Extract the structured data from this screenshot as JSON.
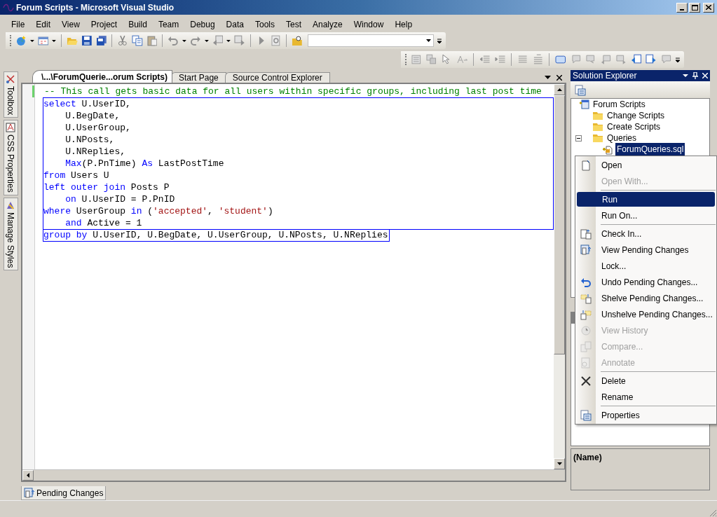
{
  "window": {
    "title": "Forum Scripts - Microsoft Visual Studio"
  },
  "menu_bar": [
    "File",
    "Edit",
    "View",
    "Project",
    "Build",
    "Team",
    "Debug",
    "Data",
    "Tools",
    "Test",
    "Analyze",
    "Window",
    "Help"
  ],
  "side_tabs": [
    "Toolbox",
    "CSS Properties",
    "Manage Styles"
  ],
  "editor_tabs": [
    {
      "label": "\\...\\ForumQuerie...orum Scripts)",
      "selected": true
    },
    {
      "label": "Start Page",
      "selected": false
    },
    {
      "label": "Source Control Explorer",
      "selected": false
    }
  ],
  "code_lines": [
    {
      "modified": true,
      "selected": false,
      "segments": [
        {
          "kind": "comment",
          "text": "-- This call gets basic data for all users within specific groups, including last post time"
        }
      ]
    },
    {
      "modified": false,
      "selected": true,
      "segments": [
        {
          "kind": "keyword",
          "text": "select"
        },
        {
          "kind": "plain",
          "text": " U.UserID,"
        }
      ]
    },
    {
      "modified": false,
      "selected": true,
      "segments": [
        {
          "kind": "plain",
          "text": "    U.BegDate,"
        }
      ]
    },
    {
      "modified": false,
      "selected": true,
      "segments": [
        {
          "kind": "plain",
          "text": "    U.UserGroup,"
        }
      ]
    },
    {
      "modified": false,
      "selected": true,
      "segments": [
        {
          "kind": "plain",
          "text": "    U.NPosts,"
        }
      ]
    },
    {
      "modified": false,
      "selected": true,
      "segments": [
        {
          "kind": "plain",
          "text": "    U.NReplies,"
        }
      ]
    },
    {
      "modified": false,
      "selected": true,
      "segments": [
        {
          "kind": "keyword",
          "text": "    Max"
        },
        {
          "kind": "plain",
          "text": "(P.PnTime) "
        },
        {
          "kind": "keyword",
          "text": "As"
        },
        {
          "kind": "plain",
          "text": " LastPostTime"
        }
      ]
    },
    {
      "modified": false,
      "selected": true,
      "segments": [
        {
          "kind": "keyword",
          "text": "from"
        },
        {
          "kind": "plain",
          "text": " Users U"
        }
      ]
    },
    {
      "modified": false,
      "selected": true,
      "segments": [
        {
          "kind": "keyword",
          "text": "left outer join"
        },
        {
          "kind": "plain",
          "text": " Posts P"
        }
      ]
    },
    {
      "modified": false,
      "selected": true,
      "segments": [
        {
          "kind": "keyword",
          "text": "    on"
        },
        {
          "kind": "plain",
          "text": " U.UserID = P.PnID"
        }
      ]
    },
    {
      "modified": false,
      "selected": true,
      "segments": [
        {
          "kind": "keyword",
          "text": "where"
        },
        {
          "kind": "plain",
          "text": " UserGroup "
        },
        {
          "kind": "keyword",
          "text": "in"
        },
        {
          "kind": "plain",
          "text": " ("
        },
        {
          "kind": "string",
          "text": "'accepted'"
        },
        {
          "kind": "plain",
          "text": ", "
        },
        {
          "kind": "string",
          "text": "'student'"
        },
        {
          "kind": "plain",
          "text": ")"
        }
      ]
    },
    {
      "modified": false,
      "selected": true,
      "segments": [
        {
          "kind": "keyword",
          "text": "    and"
        },
        {
          "kind": "plain",
          "text": " Active = 1"
        }
      ]
    },
    {
      "modified": false,
      "selected": true,
      "segments": [
        {
          "kind": "keyword",
          "text": "group by"
        },
        {
          "kind": "plain",
          "text": " U.UserID, U.BegDate, U.UserGroup, U.NPosts, U.NReplies"
        }
      ]
    }
  ],
  "bottom_tabs": [
    "Pending Changes"
  ],
  "solution_explorer": {
    "title": "Solution Explorer",
    "tree": [
      {
        "label": "Forum Scripts",
        "kind": "project",
        "selected": false,
        "children": [
          {
            "label": "Change Scripts",
            "kind": "folder",
            "selected": false
          },
          {
            "label": "Create Scripts",
            "kind": "folder",
            "selected": false
          },
          {
            "label": "Queries",
            "kind": "folder",
            "selected": false,
            "expanded": true,
            "children": [
              {
                "label": "ForumQueries.sql",
                "kind": "file",
                "selected": true
              }
            ]
          }
        ]
      }
    ]
  },
  "properties": {
    "description_title": "(Name)"
  },
  "context_menu": [
    {
      "kind": "item",
      "label": "Open",
      "disabled": false,
      "selected": false
    },
    {
      "kind": "item",
      "label": "Open With...",
      "disabled": true,
      "selected": false
    },
    {
      "kind": "separator"
    },
    {
      "kind": "item",
      "label": "Run",
      "disabled": false,
      "selected": true
    },
    {
      "kind": "item",
      "label": "Run On...",
      "disabled": false,
      "selected": false
    },
    {
      "kind": "separator"
    },
    {
      "kind": "item",
      "label": "Check In...",
      "disabled": false,
      "selected": false
    },
    {
      "kind": "item",
      "label": "View Pending Changes",
      "disabled": false,
      "selected": false
    },
    {
      "kind": "item",
      "label": "Lock...",
      "disabled": false,
      "selected": false
    },
    {
      "kind": "item",
      "label": "Undo Pending Changes...",
      "disabled": false,
      "selected": false
    },
    {
      "kind": "item",
      "label": "Shelve Pending Changes...",
      "disabled": false,
      "selected": false
    },
    {
      "kind": "item",
      "label": "Unshelve Pending Changes...",
      "disabled": false,
      "selected": false
    },
    {
      "kind": "item",
      "label": "View History",
      "disabled": true,
      "selected": false
    },
    {
      "kind": "item",
      "label": "Compare...",
      "disabled": true,
      "selected": false
    },
    {
      "kind": "item",
      "label": "Annotate",
      "disabled": true,
      "selected": false
    },
    {
      "kind": "separator"
    },
    {
      "kind": "item",
      "label": "Delete",
      "disabled": false,
      "selected": false
    },
    {
      "kind": "item",
      "label": "Rename",
      "disabled": false,
      "selected": false
    },
    {
      "kind": "separator"
    },
    {
      "kind": "item",
      "label": "Properties",
      "disabled": false,
      "selected": false
    }
  ]
}
